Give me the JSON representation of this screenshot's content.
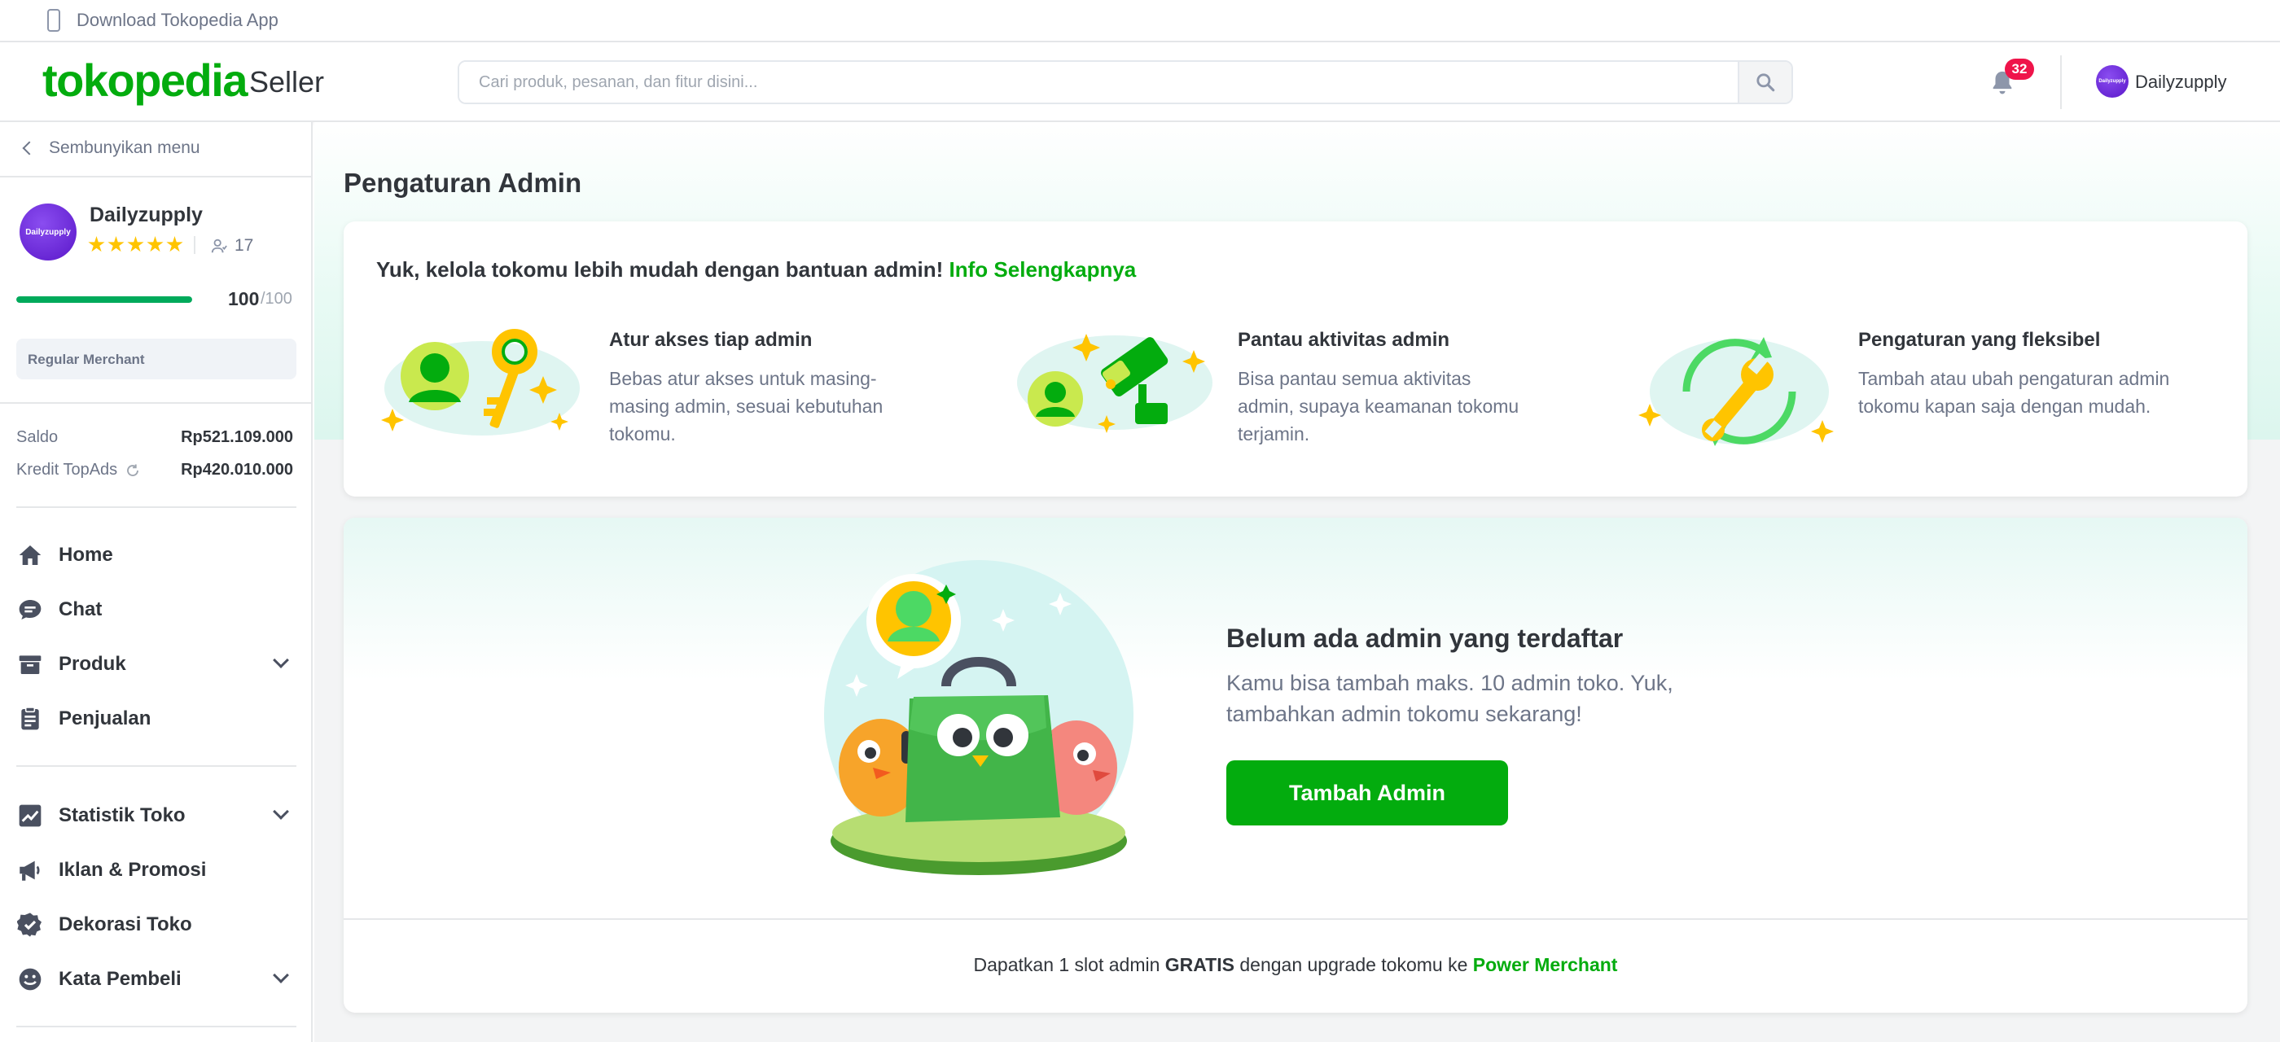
{
  "topbar": {
    "app_download": "Download Tokopedia App"
  },
  "header": {
    "logo": "tokopedia",
    "logo_suffix": "Seller",
    "search_placeholder": "Cari produk, pesanan, dan fitur disini...",
    "notification_count": "32",
    "user_name": "Dailyzupply",
    "avatar_text": "Dailyzupply"
  },
  "sidebar": {
    "hide_menu": "Sembunyikan menu",
    "shop": {
      "name": "Dailyzupply",
      "avatar_text": "Dailyzupply",
      "stars": 5,
      "followers": "17",
      "score": "100",
      "score_max": "/100",
      "score_fraction": 1.0,
      "merchant_type": "Regular Merchant"
    },
    "finance": {
      "saldo_label": "Saldo",
      "saldo_value": "Rp521.109.000",
      "topads_label": "Kredit TopAds",
      "topads_value": "Rp420.010.000"
    },
    "nav": [
      {
        "label": "Home",
        "icon": "home-icon"
      },
      {
        "label": "Chat",
        "icon": "chat-icon"
      },
      {
        "label": "Produk",
        "icon": "box-icon",
        "expandable": true
      },
      {
        "label": "Penjualan",
        "icon": "clipboard-icon"
      },
      {
        "label": "Statistik Toko",
        "icon": "chart-icon",
        "expandable": true
      },
      {
        "label": "Iklan & Promosi",
        "icon": "megaphone-icon"
      },
      {
        "label": "Dekorasi Toko",
        "icon": "badge-check-icon"
      },
      {
        "label": "Kata Pembeli",
        "icon": "smiley-icon",
        "expandable": true
      }
    ]
  },
  "main": {
    "page_title": "Pengaturan Admin",
    "info": {
      "heading": "Yuk, kelola tokomu lebih mudah dengan bantuan admin!",
      "link": "Info Selengkapnya",
      "features": [
        {
          "title": "Atur akses tiap admin",
          "desc": "Bebas atur akses untuk masing-masing admin, sesuai kebutuhan tokomu.",
          "icon": "user-key-illustration"
        },
        {
          "title": "Pantau aktivitas admin",
          "desc": "Bisa pantau semua aktivitas admin, supaya keamanan tokomu terjamin.",
          "icon": "cctv-illustration"
        },
        {
          "title": "Pengaturan yang fleksibel",
          "desc": "Tambah atau ubah pengaturan admin tokomu kapan saja dengan mudah.",
          "icon": "wrench-sync-illustration"
        }
      ]
    },
    "empty": {
      "title": "Belum ada admin yang terdaftar",
      "desc": "Kamu bisa tambah maks. 10 admin toko. Yuk, tambahkan admin tokomu sekarang!",
      "button": "Tambah Admin",
      "illustration": "mascot-support-illustration"
    },
    "footer": {
      "prefix": "Dapatkan 1 slot admin",
      "bold": "GRATIS",
      "middle": "dengan upgrade tokomu ke",
      "link": "Power Merchant"
    }
  },
  "colors": {
    "brand_green": "#03ac0e",
    "badge_red": "#ef144a",
    "text_dark": "#31353b",
    "text_muted": "#6d7588",
    "star_yellow": "#ffc400"
  }
}
